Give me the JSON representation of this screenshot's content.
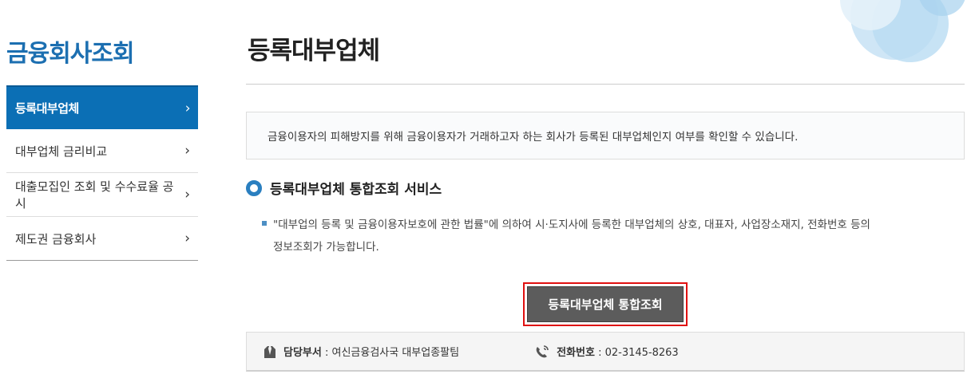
{
  "sidebar": {
    "title": "금융회사조회",
    "items": [
      {
        "label": "등록대부업체",
        "chevron": "›"
      },
      {
        "label": "대부업체 금리비교",
        "chevron": "›"
      },
      {
        "label": "대출모집인 조회 및 수수료율 공시",
        "chevron": "›"
      },
      {
        "label": "제도권 금융회사",
        "chevron": "›"
      }
    ]
  },
  "main": {
    "title": "등록대부업체",
    "notice": "금융이용자의 피해방지를 위해 금융이용자가 거래하고자 하는 회사가 등록된 대부업체인지 여부를 확인할 수 있습니다.",
    "section": {
      "title": "등록대부업체 통합조회 서비스",
      "desc_line1": "\"대부업의 등록 및 금융이용자보호에 관한 법률\"에 의하여 시·도지사에 등록한 대부업체의 상호, 대표자, 사업장소재지, 전화번호 등의",
      "desc_line2": "정보조회가 가능합니다."
    },
    "button_label": "등록대부업체 통합조회",
    "contact": {
      "dept_label": "담당부서",
      "dept_value": " : 여신금융검사국 대부업종팔팀",
      "phone_label": "전화번호",
      "phone_value": " : 02-3145-8263"
    }
  },
  "icons": {
    "dept": "necktie-person-icon",
    "phone": "phone-icon",
    "section": "ring-bullet-icon"
  },
  "colors": {
    "accent": "#0b6fb5",
    "highlight_border": "#e01010",
    "button_bg": "#5c5c5c"
  }
}
